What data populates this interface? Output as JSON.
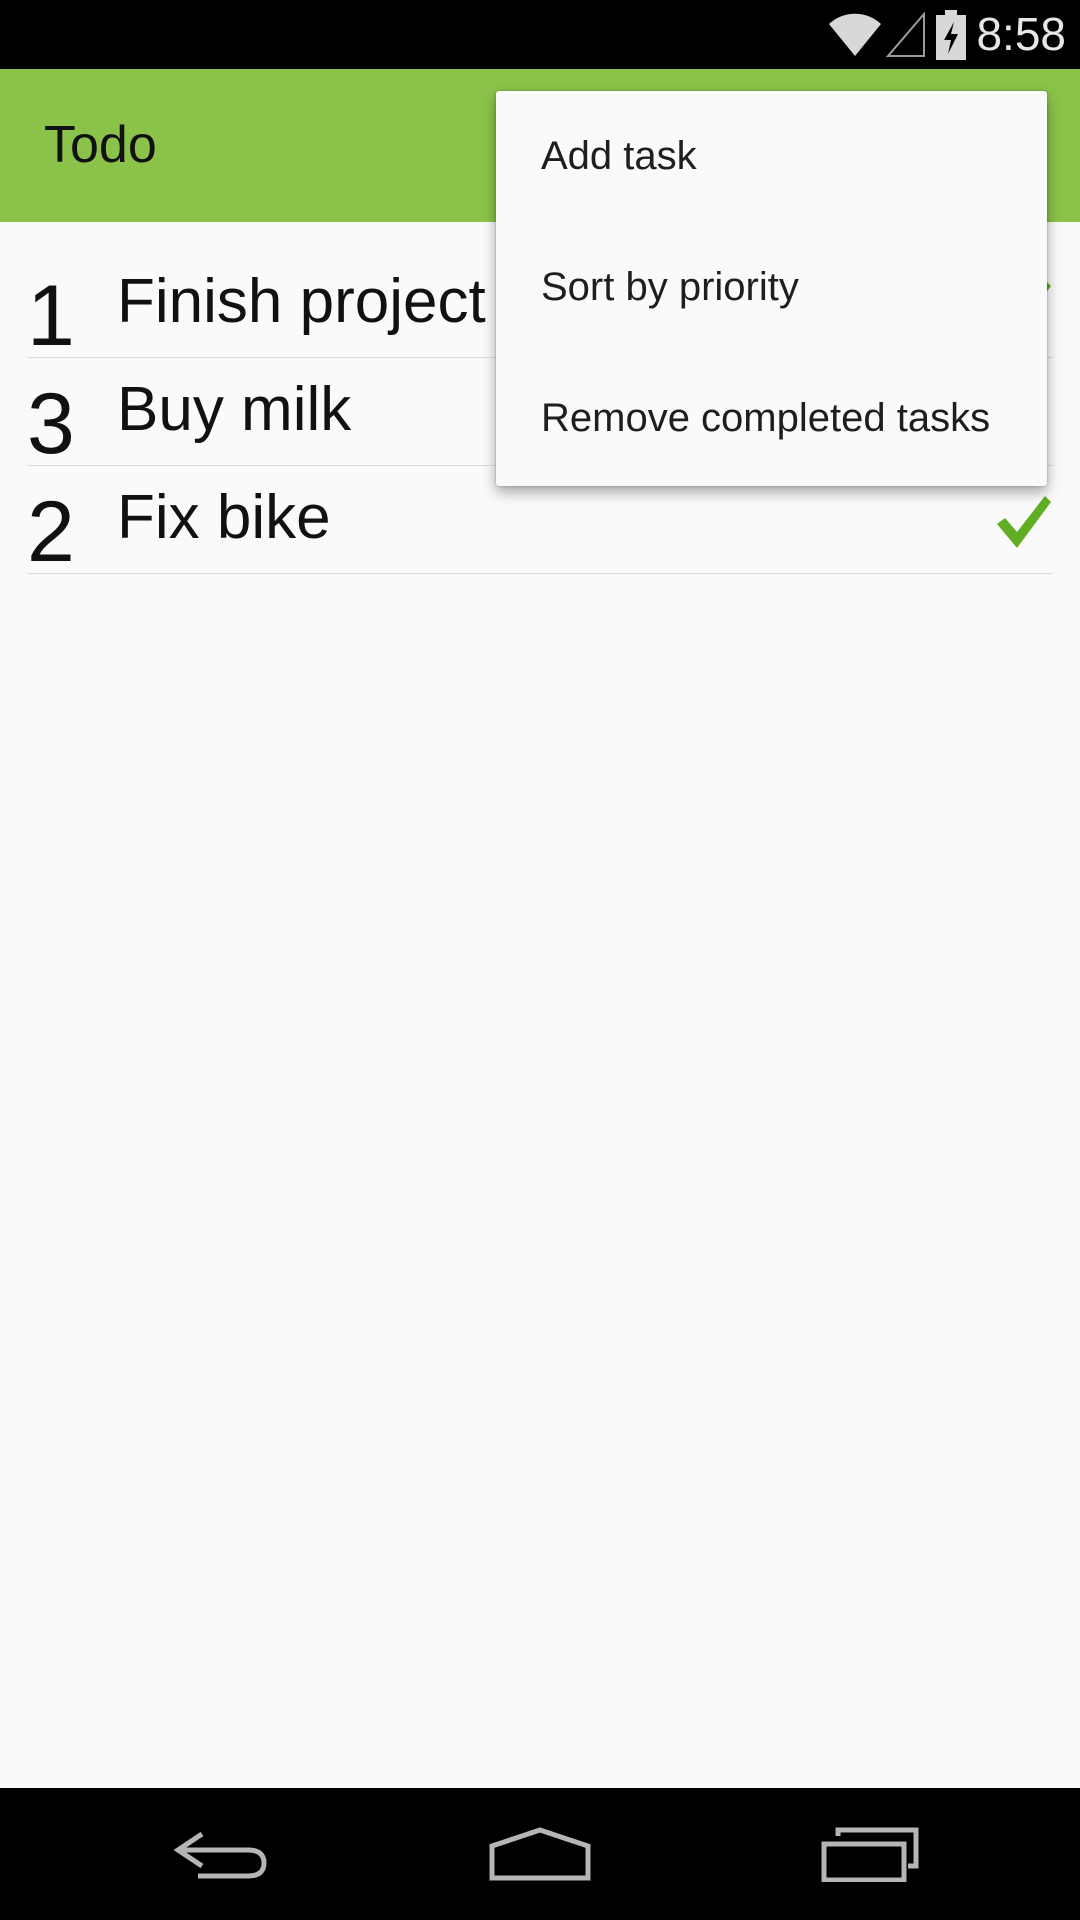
{
  "status_bar": {
    "time": "8:58",
    "icons": [
      "wifi-icon",
      "cell-signal-icon",
      "battery-charging-icon"
    ]
  },
  "app_bar": {
    "title": "Todo",
    "color": "#8bc34a"
  },
  "tasks": [
    {
      "priority": "1",
      "name": "Finish project",
      "completed": true
    },
    {
      "priority": "3",
      "name": "Buy milk",
      "completed": false
    },
    {
      "priority": "2",
      "name": "Fix bike",
      "completed": true
    }
  ],
  "overflow_menu": {
    "items": [
      "Add task",
      "Sort by priority",
      "Remove completed tasks"
    ]
  },
  "nav_bar": {
    "icons": [
      "back-icon",
      "home-icon",
      "recents-icon"
    ]
  },
  "colors": {
    "accent": "#8bc34a",
    "check": "#5fae23"
  }
}
